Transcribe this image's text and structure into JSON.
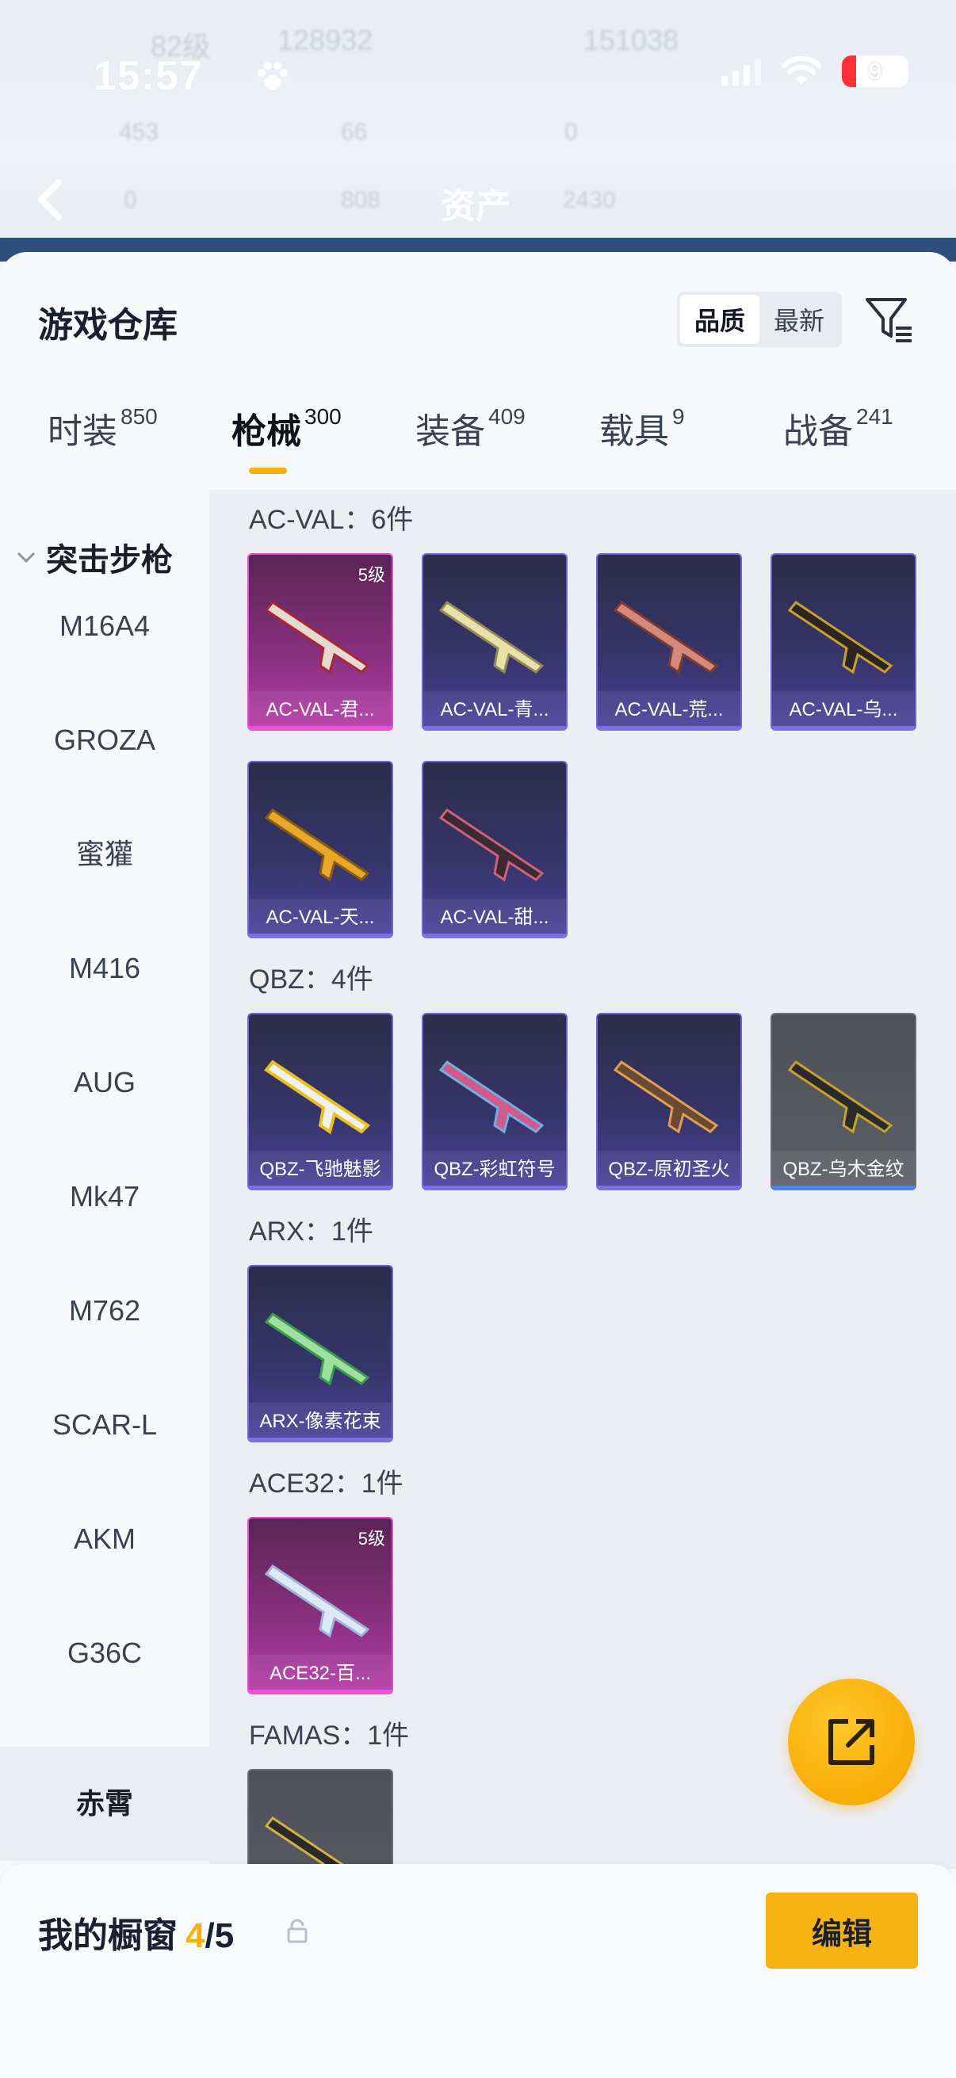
{
  "status_bar": {
    "time": "15:57",
    "battery": "9"
  },
  "background": {
    "title": "资产",
    "stats": [
      {
        "text": "82级"
      },
      {
        "text": "128932"
      },
      {
        "text": "151038"
      },
      {
        "text": "453"
      },
      {
        "text": "66"
      },
      {
        "text": "0"
      },
      {
        "text": "0"
      },
      {
        "text": "808"
      },
      {
        "text": "2430"
      }
    ]
  },
  "header": {
    "title": "游戏仓库",
    "sort_options": [
      {
        "label": "品质",
        "active": true
      },
      {
        "label": "最新",
        "active": false
      }
    ],
    "filter_icon": "filter-icon"
  },
  "category_tabs": [
    {
      "label": "时装",
      "count": "850",
      "active": false
    },
    {
      "label": "枪械",
      "count": "300",
      "active": true
    },
    {
      "label": "装备",
      "count": "409",
      "active": false
    },
    {
      "label": "载具",
      "count": "9",
      "active": false
    },
    {
      "label": "战备",
      "count": "241",
      "active": false
    }
  ],
  "sidebar": {
    "group": "突击步枪",
    "items": [
      "M16A4",
      "GROZA",
      "蜜獾",
      "M416",
      "AUG",
      "Mk47",
      "M762",
      "SCAR-L",
      "AKM",
      "G36C",
      "赤霄"
    ],
    "selected": "赤霄"
  },
  "sections": [
    {
      "title": "AC-VAL：6件",
      "cards": [
        {
          "name": "AC-VAL-君...",
          "level": "5级",
          "rarity": "purple"
        },
        {
          "name": "AC-VAL-青...",
          "rarity": "blue"
        },
        {
          "name": "AC-VAL-荒...",
          "rarity": "blue"
        },
        {
          "name": "AC-VAL-乌...",
          "rarity": "blue"
        },
        {
          "name": "AC-VAL-天...",
          "rarity": "blue"
        },
        {
          "name": "AC-VAL-甜...",
          "rarity": "blue"
        }
      ]
    },
    {
      "title": "QBZ：4件",
      "cards": [
        {
          "name": "QBZ-飞驰魅影",
          "rarity": "blue"
        },
        {
          "name": "QBZ-彩虹符号",
          "rarity": "blue"
        },
        {
          "name": "QBZ-原初圣火",
          "rarity": "blue"
        },
        {
          "name": "QBZ-乌木金纹",
          "rarity": "gray"
        }
      ]
    },
    {
      "title": "ARX：1件",
      "cards": [
        {
          "name": "ARX-像素花束",
          "rarity": "blue"
        }
      ]
    },
    {
      "title": "ACE32：1件",
      "cards": [
        {
          "name": "ACE32-百...",
          "level": "5级",
          "rarity": "purple"
        }
      ]
    },
    {
      "title": "FAMAS：1件",
      "cards": [
        {
          "name": "",
          "rarity": "gray"
        }
      ]
    }
  ],
  "bottom_bar": {
    "title": "我的橱窗",
    "current": "4",
    "separator": "/",
    "max": "5",
    "edit_label": "编辑"
  },
  "colors": {
    "accent": "#f5b20f",
    "blue_card_border": "#6f63d8",
    "purple_card_border": "#e04ccf"
  }
}
